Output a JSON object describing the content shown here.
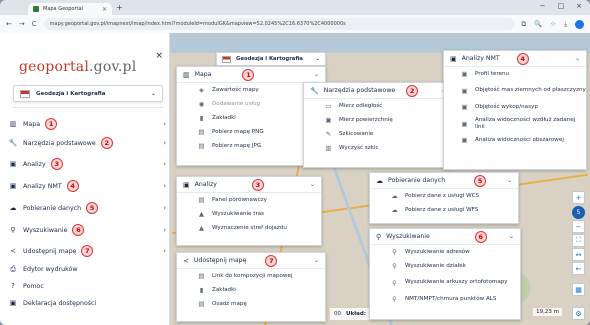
{
  "browser": {
    "tab_title": "Mapa Geoportal",
    "tab_close": "×",
    "new_tab": "+",
    "window_controls": [
      "−",
      "□",
      "×"
    ],
    "url": "mapy.geoportal.gov.pl/imapnext/imap/index.html?moduleId=modulGK&mapview=52.0245%2C16.6370%2C4000000s",
    "nav": [
      "←",
      "→",
      "C"
    ],
    "tools": [
      "⧉",
      "🔍",
      "☆",
      "⤓"
    ]
  },
  "sidebar": {
    "logo_main": "geoportal",
    "logo_suffix": ".gov.pl",
    "close": "×",
    "theme": {
      "label": "Geodezja i Kartografia",
      "chevron": "⌄"
    },
    "items": [
      {
        "label": "Mapa",
        "icon": "map-icon",
        "glyph": "▥",
        "badge": "1",
        "arrow": "›"
      },
      {
        "label": "Narzędzia podstawowe",
        "icon": "wrench-icon",
        "glyph": "🔧",
        "badge": "2",
        "arrow": "›"
      },
      {
        "label": "Analizy",
        "icon": "analysis-icon",
        "glyph": "▣",
        "badge": "3",
        "arrow": "›"
      },
      {
        "label": "Analizy NMT",
        "icon": "terrain-icon",
        "glyph": "▣",
        "badge": "4",
        "arrow": "›"
      },
      {
        "label": "Pobieranie danych",
        "icon": "cloud-download-icon",
        "glyph": "☁",
        "badge": "5",
        "arrow": "›"
      },
      {
        "label": "Wyszukiwanie",
        "icon": "search-icon",
        "glyph": "⚲",
        "badge": "6",
        "arrow": "›"
      },
      {
        "label": "Udostępnij mapę",
        "icon": "share-icon",
        "glyph": "≺",
        "badge": "7",
        "arrow": "›"
      },
      {
        "label": "Edytor wydruków",
        "icon": "printer-icon",
        "glyph": "⎙",
        "badge": "",
        "arrow": ""
      },
      {
        "label": "Pomoc",
        "icon": "help-icon",
        "glyph": "?",
        "badge": "",
        "arrow": ""
      },
      {
        "label": "Deklaracja dostępności",
        "icon": "accessibility-icon",
        "glyph": "▣",
        "badge": "",
        "arrow": ""
      }
    ]
  },
  "map": {
    "theme_dropdown": "Geodezja i Kartografia",
    "status_label": "Układ:",
    "status_value": "",
    "status_prefix": "00",
    "scale_text": "19,23 m",
    "controls": [
      "+",
      "−",
      "⛶",
      "↔",
      "←",
      "▦",
      "⚙"
    ],
    "zoom_level": "5"
  },
  "panels": {
    "mapa": {
      "title": "Mapa",
      "badge": "1",
      "chevron": "⌄",
      "rows": [
        {
          "label": "Zawartość mapy",
          "icon": "layers-icon",
          "glyph": "◈"
        },
        {
          "label": "Dodawanie usług",
          "icon": "add-service-icon",
          "glyph": "◉",
          "muted": true
        },
        {
          "label": "Zakładki",
          "icon": "bookmark-icon",
          "glyph": "▮"
        },
        {
          "label": "Pobierz mapę PNG",
          "icon": "png-icon",
          "glyph": "▤"
        },
        {
          "label": "Pobierz mapę JPG",
          "icon": "jpg-icon",
          "glyph": "▤"
        }
      ]
    },
    "narzedzia": {
      "title": "Narzędzia podstawowe",
      "badge": "2",
      "chevron": "⌄",
      "rows": [
        {
          "label": "Mierz odległość",
          "icon": "ruler-icon",
          "glyph": "▭"
        },
        {
          "label": "Mierz powierzchnię",
          "icon": "area-icon",
          "glyph": "▣"
        },
        {
          "label": "Szkicowanie",
          "icon": "pencil-icon",
          "glyph": "✎"
        },
        {
          "label": "Wyczyść szkic",
          "icon": "trash-icon",
          "glyph": "▥"
        }
      ]
    },
    "analizy": {
      "title": "Analizy",
      "badge": "3",
      "chevron": "⌄",
      "rows": [
        {
          "label": "Panel porównawczy",
          "icon": "compare-icon",
          "glyph": "▤"
        },
        {
          "label": "Wyszukiwanie tras",
          "icon": "route-icon",
          "glyph": "▲"
        },
        {
          "label": "Wyznaczenie stref dojazdu",
          "icon": "zones-icon",
          "glyph": "▲"
        }
      ]
    },
    "nmt": {
      "title": "Analizy NMT",
      "badge": "4",
      "chevron": "⌄",
      "rows": [
        {
          "label": "Profil terenu",
          "icon": "profile-icon",
          "glyph": "▣"
        },
        {
          "label": "Objętość mas ziemnych od płaszczyzny",
          "icon": "volume-plane-icon",
          "glyph": "▣"
        },
        {
          "label": "Objętość wykop/nasyp",
          "icon": "volume-icon",
          "glyph": "▣"
        },
        {
          "label": "Analiza widoczności wzdłuż zadanej linii",
          "icon": "visibility-line-icon",
          "glyph": "▣"
        },
        {
          "label": "Analiza widoczności obszarowej",
          "icon": "visibility-area-icon",
          "glyph": "▣"
        }
      ]
    },
    "pobieranie": {
      "title": "Pobieranie danych",
      "badge": "5",
      "chevron": "⌄",
      "rows": [
        {
          "label": "Pobierz dane z usługi WCS",
          "icon": "cloud-download-icon",
          "glyph": "☁"
        },
        {
          "label": "Pobierz dane z usługi WFS",
          "icon": "cloud-download-icon",
          "glyph": "☁"
        }
      ]
    },
    "wyszukiwanie": {
      "title": "Wyszukiwanie",
      "badge": "6",
      "chevron": "⌄",
      "rows": [
        {
          "label": "Wyszukiwanie adresów",
          "icon": "search-icon",
          "glyph": "⚲"
        },
        {
          "label": "Wyszukiwanie działek",
          "icon": "search-icon",
          "glyph": "⚲"
        },
        {
          "label": "Wyszukiwanie arkuszy ortofotomapy",
          "icon": "search-icon",
          "glyph": "⚲"
        },
        {
          "label": "NMT/NMPT/chmura punktów ALS",
          "icon": "search-icon",
          "glyph": "⚲"
        }
      ]
    },
    "udostepnij": {
      "title": "Udostępnij mapę",
      "badge": "7",
      "chevron": "⌄",
      "rows": [
        {
          "label": "Link do kompozycji mapowej",
          "icon": "link-icon",
          "glyph": "▤"
        },
        {
          "label": "Zakładki",
          "icon": "bookmark-icon",
          "glyph": "▮"
        },
        {
          "label": "Osadź mapę",
          "icon": "embed-icon",
          "glyph": "▤"
        }
      ]
    }
  },
  "colors": {
    "accent": "#1a5fb4",
    "badge_border": "#dd3333",
    "badge_fill": "#ffd6d6",
    "logo_red": "#c43a2a"
  }
}
